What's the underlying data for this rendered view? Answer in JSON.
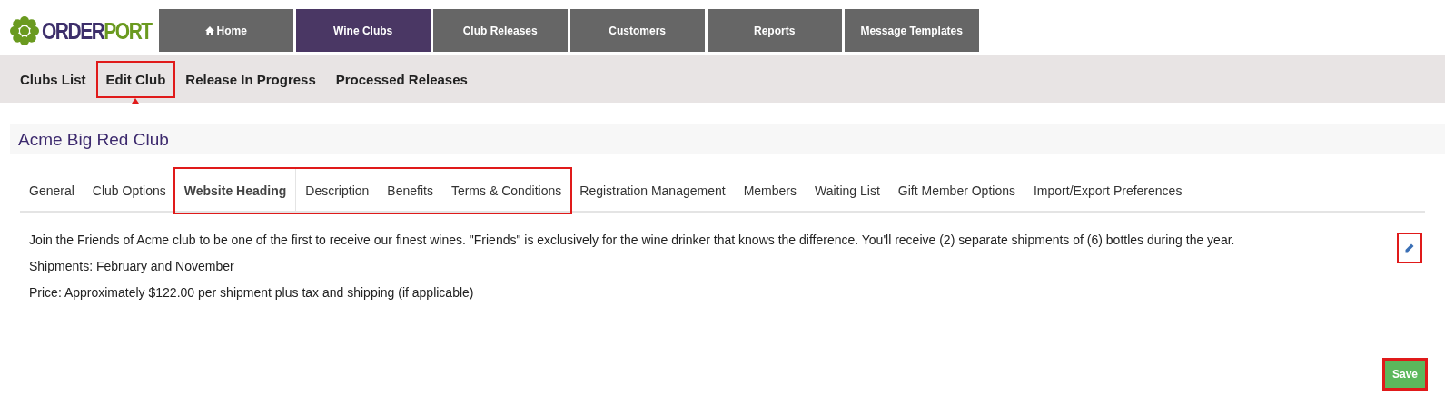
{
  "logo": {
    "first": "ORDER",
    "second": "PORT"
  },
  "nav": [
    {
      "label": "Home",
      "kind": "home",
      "selected": false
    },
    {
      "label": "Wine Clubs",
      "kind": "plain",
      "selected": true
    },
    {
      "label": "Club Releases",
      "kind": "plain",
      "selected": false
    },
    {
      "label": "Customers",
      "kind": "plain",
      "selected": false
    },
    {
      "label": "Reports",
      "kind": "plain",
      "selected": false
    },
    {
      "label": "Message Templates",
      "kind": "plain",
      "selected": false
    }
  ],
  "subnav": [
    {
      "label": "Clubs List",
      "highlighted": false
    },
    {
      "label": "Edit Club",
      "highlighted": true
    },
    {
      "label": "Release In Progress",
      "highlighted": false
    },
    {
      "label": "Processed Releases",
      "highlighted": false
    }
  ],
  "club_title": "Acme Big Red Club",
  "tabs": [
    {
      "label": "General",
      "selected": false,
      "highlighted": false
    },
    {
      "label": "Club Options",
      "selected": false,
      "highlighted": false
    },
    {
      "label": "Website Heading",
      "selected": true,
      "highlighted": true
    },
    {
      "label": "Description",
      "selected": false,
      "highlighted": true
    },
    {
      "label": "Benefits",
      "selected": false,
      "highlighted": true
    },
    {
      "label": "Terms & Conditions",
      "selected": false,
      "highlighted": true
    },
    {
      "label": "Registration Management",
      "selected": false,
      "highlighted": false
    },
    {
      "label": "Members",
      "selected": false,
      "highlighted": false
    },
    {
      "label": "Waiting List",
      "selected": false,
      "highlighted": false
    },
    {
      "label": "Gift Member Options",
      "selected": false,
      "highlighted": false
    },
    {
      "label": "Import/Export Preferences",
      "selected": false,
      "highlighted": false
    }
  ],
  "content": {
    "paragraphs": [
      "Join the Friends of Acme club to be one of the first to receive our finest wines.  \"Friends\" is exclusively for the wine drinker that knows the difference.  You'll receive (2) separate shipments of (6) bottles during the year.",
      "Shipments: February and November",
      "Price: Approximately $122.00 per shipment plus tax and shipping (if applicable)"
    ],
    "edit_highlighted": true
  },
  "save": {
    "label": "Save",
    "highlighted": true
  }
}
